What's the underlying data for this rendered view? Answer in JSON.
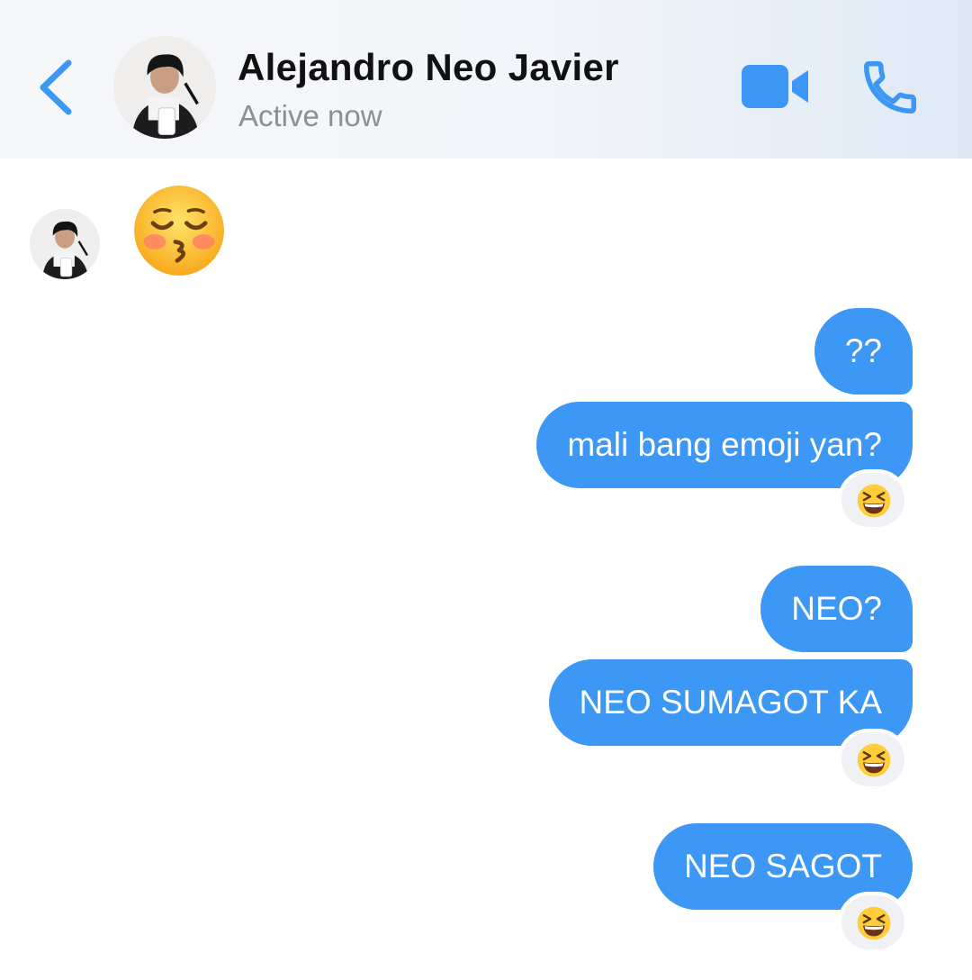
{
  "header": {
    "contact_name": "Alejandro Neo Javier",
    "status": "Active now"
  },
  "icons": {
    "back": "chevron-left-icon",
    "video_call": "video-camera-icon",
    "voice_call": "phone-icon",
    "received_emoji": "kissing-face-with-closed-eyes",
    "reaction_emoji": "grinning-squinting-face"
  },
  "colors": {
    "accent": "#3d97f5",
    "bubble_text": "#ffffff",
    "status_text": "#8c8f94",
    "reaction_bg": "#eff1f4"
  },
  "messages": [
    {
      "from": "contact",
      "type": "emoji",
      "emoji": "kissing-face-with-closed-eyes"
    },
    {
      "from": "me",
      "text": "??"
    },
    {
      "from": "me",
      "text": "mali bang emoji yan?",
      "reaction": "grinning-squinting-face"
    },
    {
      "from": "me",
      "text": "NEO?"
    },
    {
      "from": "me",
      "text": "NEO SUMAGOT KA",
      "reaction": "grinning-squinting-face"
    },
    {
      "from": "me",
      "text": "NEO SAGOT",
      "reaction": "grinning-squinting-face"
    }
  ]
}
